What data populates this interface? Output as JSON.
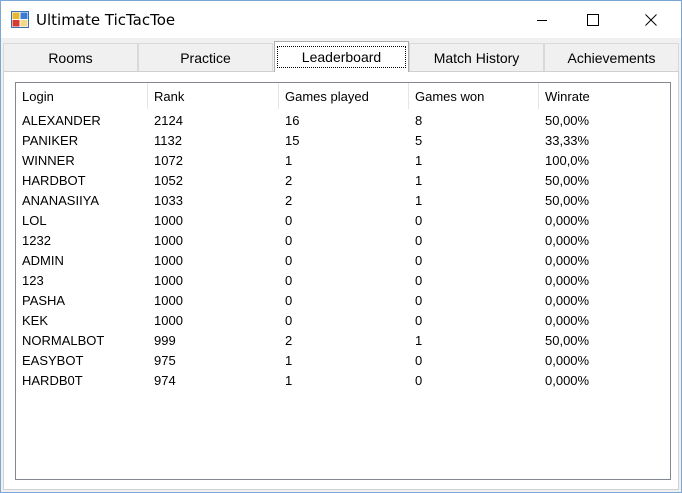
{
  "window": {
    "title": "Ultimate TicTacToe"
  },
  "tabs": [
    {
      "label": "Rooms"
    },
    {
      "label": "Practice"
    },
    {
      "label": "Leaderboard",
      "active": true
    },
    {
      "label": "Match History"
    },
    {
      "label": "Achievements"
    }
  ],
  "leaderboard": {
    "columns": [
      "Login",
      "Rank",
      "Games played",
      "Games won",
      "Winrate"
    ],
    "rows": [
      [
        "ALEXANDER",
        "2124",
        "16",
        "8",
        "50,00%"
      ],
      [
        "PANIKER",
        "1132",
        "15",
        "5",
        "33,33%"
      ],
      [
        "WINNER",
        "1072",
        "1",
        "1",
        "100,0%"
      ],
      [
        "HARDBOT",
        "1052",
        "2",
        "1",
        "50,00%"
      ],
      [
        "ANANASIIYA",
        "1033",
        "2",
        "1",
        "50,00%"
      ],
      [
        "LOL",
        "1000",
        "0",
        "0",
        "0,000%"
      ],
      [
        "1232",
        "1000",
        "0",
        "0",
        "0,000%"
      ],
      [
        "ADMIN",
        "1000",
        "0",
        "0",
        "0,000%"
      ],
      [
        "123",
        "1000",
        "0",
        "0",
        "0,000%"
      ],
      [
        "PASHA",
        "1000",
        "0",
        "0",
        "0,000%"
      ],
      [
        "KEK",
        "1000",
        "0",
        "0",
        "0,000%"
      ],
      [
        "NORMALBOT",
        "999",
        "2",
        "1",
        "50,00%"
      ],
      [
        "EASYBOT",
        "975",
        "1",
        "0",
        "0,000%"
      ],
      [
        "HARDB0T",
        "974",
        "1",
        "0",
        "0,000%"
      ]
    ]
  },
  "icons": {
    "app": "tictactoe-app-icon",
    "minimize": "minimize-icon",
    "maximize": "maximize-icon",
    "close": "close-icon"
  }
}
